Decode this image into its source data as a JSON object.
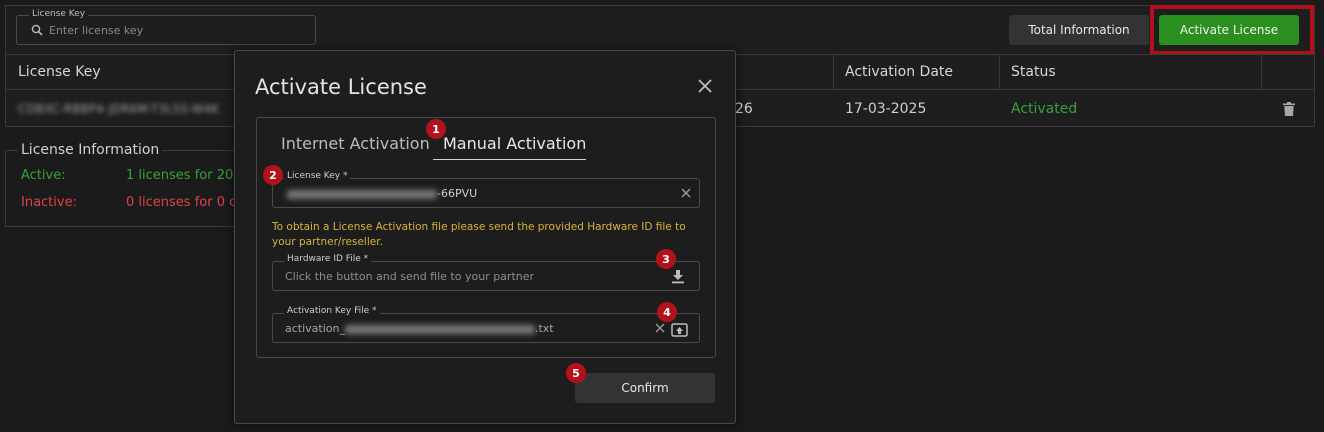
{
  "search": {
    "legend": "License Key",
    "placeholder": "Enter license key"
  },
  "toolbar": {
    "total_label": "Total Information",
    "activate_label": "Activate License"
  },
  "table": {
    "headers": {
      "license_key": "License Key",
      "activation_date": "Activation Date",
      "status": "Status"
    },
    "row": {
      "partial_date": "26",
      "activation_date": "17-03-2025",
      "status": "Activated"
    }
  },
  "license_info": {
    "legend": "License Information",
    "active_label": "Active:",
    "active_value": "1 licenses for 20",
    "inactive_label": "Inactive:",
    "inactive_value": "0 licenses for 0 c"
  },
  "modal": {
    "title": "Activate License",
    "tabs": {
      "internet": "Internet Activation",
      "manual": "Manual Activation"
    },
    "license_key": {
      "legend": "License Key *",
      "value_suffix": "-66PVU"
    },
    "notice": "To obtain a License Activation file please send the provided Hardware ID file to your partner/reseller.",
    "hardware_id": {
      "legend": "Hardware ID File *",
      "placeholder": "Click the button and send file to your partner"
    },
    "activation_key": {
      "legend": "Activation Key File *",
      "value_prefix": "activation_",
      "value_suffix": ".txt"
    },
    "confirm_label": "Confirm"
  },
  "badges": {
    "b1": "1",
    "b2": "2",
    "b3": "3",
    "b4": "4",
    "b5": "5"
  },
  "colors": {
    "accent_green": "#2a8f1e",
    "highlight_red": "#b0111b",
    "badge_red": "#b3121c",
    "notice_yellow": "#d9b33a",
    "active_green": "#3aa13a",
    "inactive_red": "#e0424a"
  }
}
